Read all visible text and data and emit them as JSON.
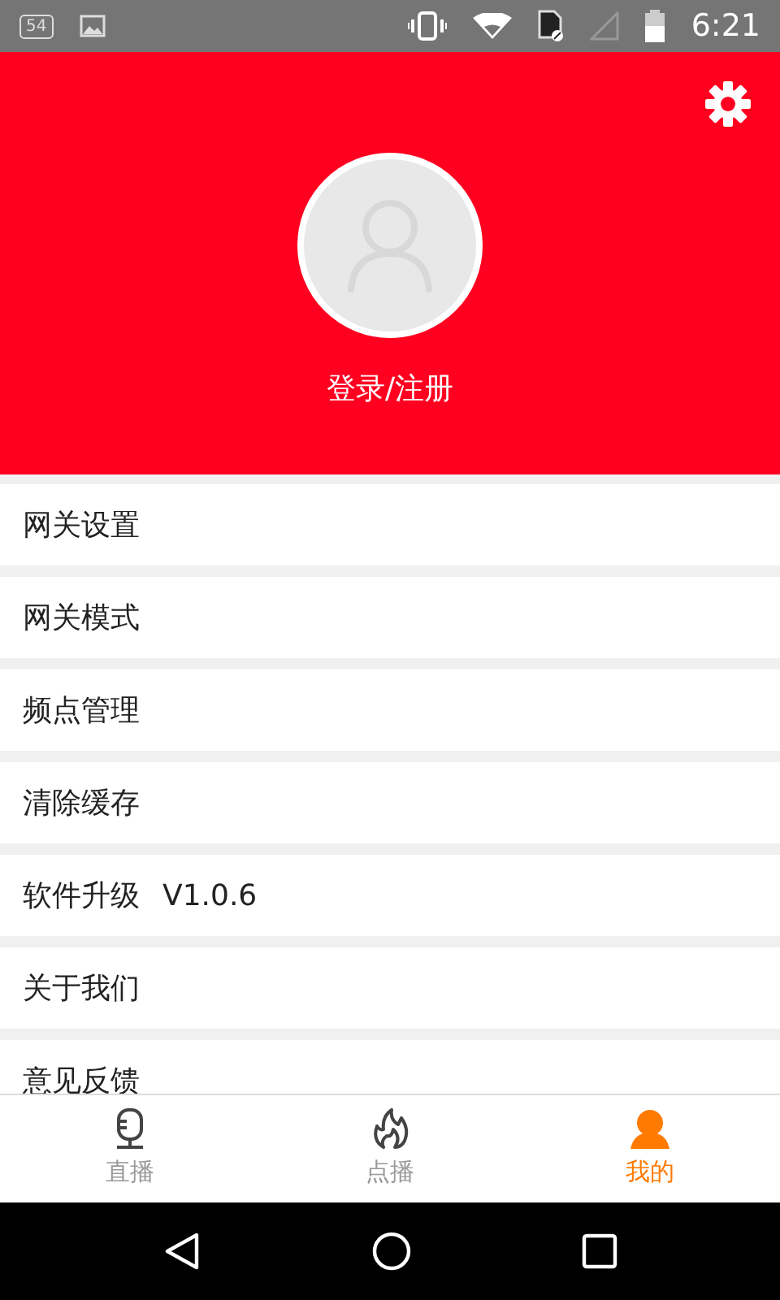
{
  "status_bar": {
    "notification_count": "54",
    "time": "6:21"
  },
  "header": {
    "login_label": "登录/注册"
  },
  "menu": [
    {
      "label": "网关设置"
    },
    {
      "label": "网关模式"
    },
    {
      "label": "频点管理"
    },
    {
      "label": "清除缓存"
    },
    {
      "label": "软件升级",
      "version": "V1.0.6"
    },
    {
      "label": "关于我们"
    },
    {
      "label": "意见反馈"
    }
  ],
  "tabs": [
    {
      "kind": "live",
      "label": "直播",
      "selected": false
    },
    {
      "kind": "vod",
      "label": "点播",
      "selected": false
    },
    {
      "kind": "me",
      "label": "我的",
      "selected": true
    }
  ]
}
